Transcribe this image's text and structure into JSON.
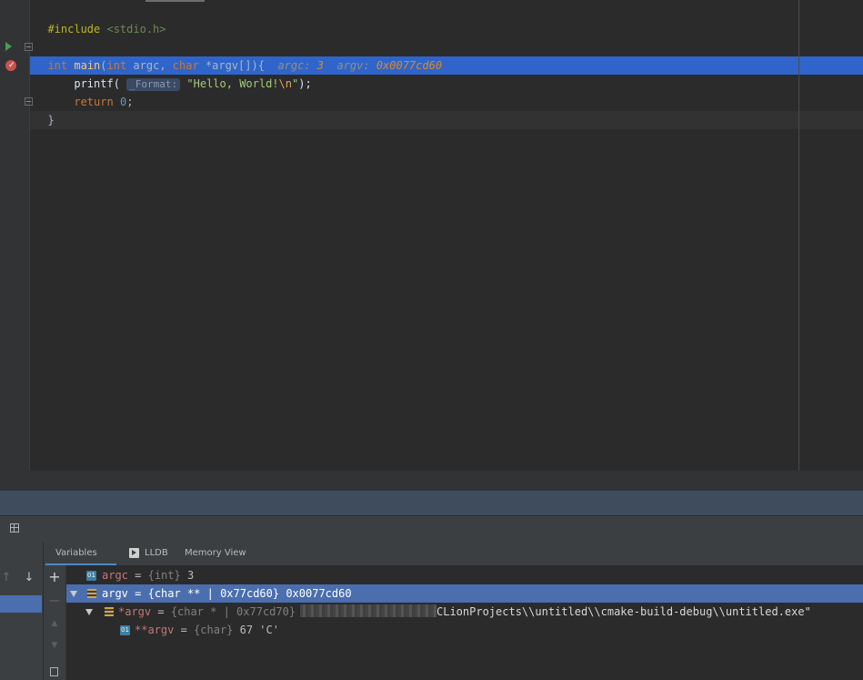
{
  "editor": {
    "line1": {
      "directive": "#include",
      "header": "<stdio.h>"
    },
    "line3": {
      "type_int": "int",
      "fn": "main",
      "open": "(",
      "type_int2": "int",
      "argc": " argc, ",
      "type_char": "char",
      "argv": " *argv[]){",
      "hint_argc_label": "argc: ",
      "hint_argc_val": "3",
      "hint_argv_label": "argv: ",
      "hint_argv_val": "0x0077cd60"
    },
    "line4": {
      "call": "printf(",
      "param_hint": "_Format:",
      "str_a": "\"Hello, World!",
      "esc": "\\n",
      "str_b": "\"",
      "close": ");"
    },
    "line5": {
      "kw": "return",
      "num": "0",
      "semi": ";"
    },
    "line6": {
      "brace": "}"
    }
  },
  "debugger": {
    "tabs": [
      {
        "label": "Variables"
      },
      {
        "label": "LLDB"
      },
      {
        "label": "Memory View"
      }
    ],
    "toolbar": {
      "up": "↑",
      "down": "↓",
      "add": "+",
      "remove": "−",
      "move_up": "▲",
      "move_down": "▼"
    },
    "variables": [
      {
        "name": "argc",
        "eq": " = ",
        "type": "{int}",
        "value": " 3",
        "icon": "primitive-icon"
      },
      {
        "name": "argv",
        "eq": " = ",
        "type": "{char ** | 0x77cd60}",
        "value": " 0x0077cd60",
        "icon": "array-icon"
      },
      {
        "name": "*argv",
        "eq": " = ",
        "type": "{char * | 0x77cd70}",
        "value": "CLionProjects\\\\untitled\\\\cmake-build-debug\\\\untitled.exe\"",
        "icon": "array-icon"
      },
      {
        "name": "**argv",
        "eq": " = ",
        "type": "{char}",
        "value": " 67 'C'",
        "icon": "primitive-icon"
      }
    ],
    "icon_labels": {
      "primitive": "01"
    }
  },
  "colors": {
    "background": "#2b2b2b",
    "selection": "#4b6eaf",
    "execution_line": "#2f65ca",
    "keyword": "#cc7832",
    "string": "#6a8759",
    "number": "#6897bb"
  }
}
